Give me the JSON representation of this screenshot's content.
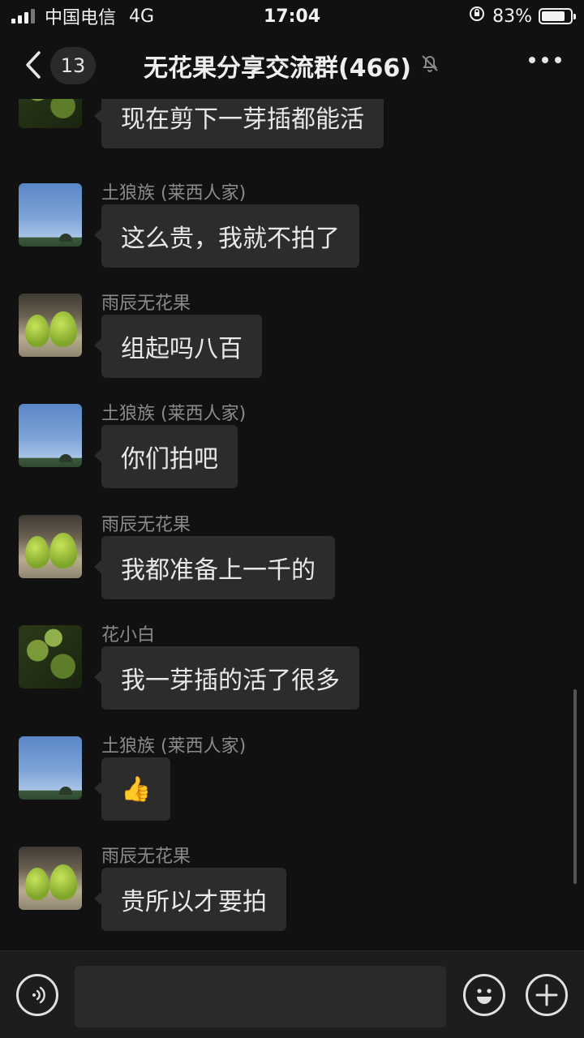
{
  "status_bar": {
    "carrier": "中国电信",
    "network": "4G",
    "time": "17:04",
    "battery_percent_text": "83%",
    "battery_level": 0.83
  },
  "nav": {
    "back_icon": "chevron-left-icon",
    "unread_count": "13",
    "title": "无花果分享交流群(466)",
    "mute_icon": "bell-slash-icon",
    "more_icon": "more-dots-icon"
  },
  "messages": [
    {
      "sender": "",
      "avatar": "leaf",
      "text": "现在剪下一芽插都能活"
    },
    {
      "sender": "土狼族 (莱西人家)",
      "avatar": "sky",
      "text": "这么贵，我就不拍了"
    },
    {
      "sender": "雨辰无花果",
      "avatar": "fig",
      "text": "组起吗八百"
    },
    {
      "sender": "土狼族 (莱西人家)",
      "avatar": "sky",
      "text": "你们拍吧"
    },
    {
      "sender": "雨辰无花果",
      "avatar": "fig",
      "text": "我都准备上一千的"
    },
    {
      "sender": "花小白",
      "avatar": "leaf",
      "text": "我一芽插的活了很多"
    },
    {
      "sender": "土狼族 (莱西人家)",
      "avatar": "sky",
      "text": "👍"
    },
    {
      "sender": "雨辰无花果",
      "avatar": "fig",
      "text": "贵所以才要拍"
    }
  ],
  "input_bar": {
    "voice_icon": "voice-icon",
    "input_value": "",
    "emoji_icon": "emoji-icon",
    "plus_icon": "plus-icon"
  },
  "colors": {
    "background": "#111111",
    "bubble": "#2c2c2c",
    "sender_name": "#8a8a8a",
    "input_bar": "#1d1d1d"
  }
}
